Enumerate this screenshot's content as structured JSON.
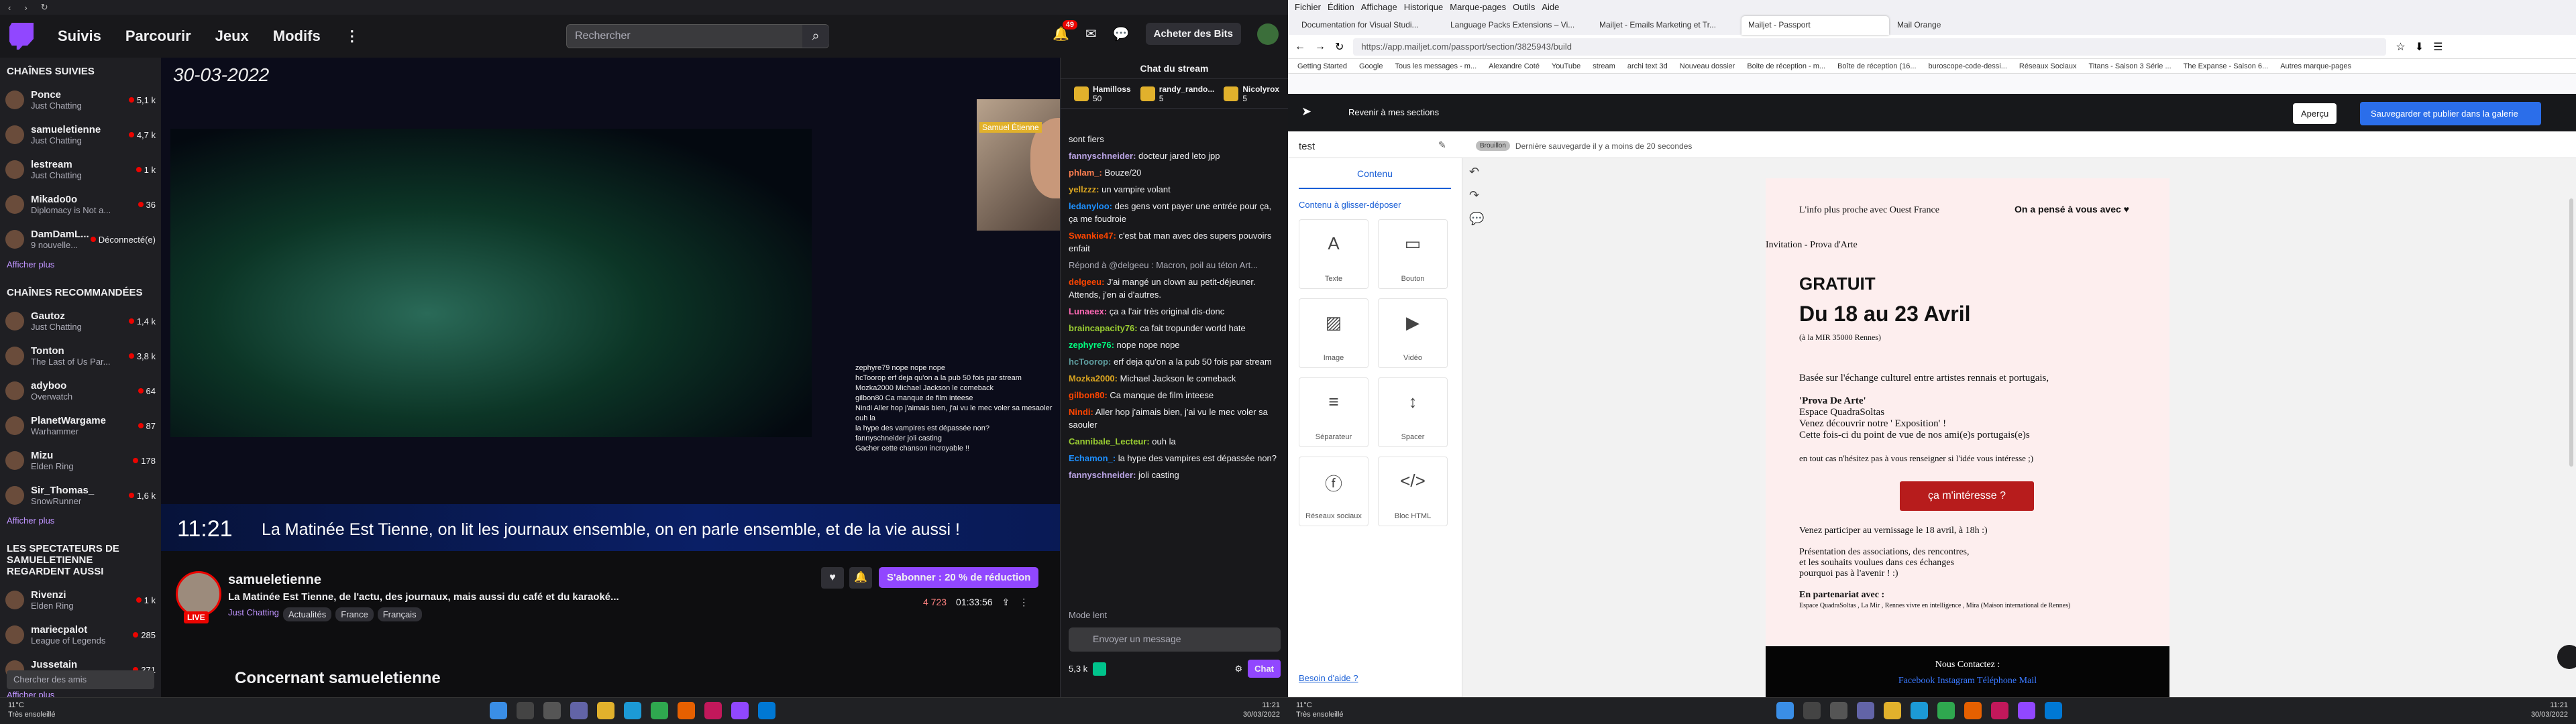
{
  "twitch": {
    "chrome_nav": [
      "‹",
      "›",
      "↻"
    ],
    "nav": {
      "following": "Suivis",
      "browse": "Parcourir",
      "games": "Jeux",
      "mods": "Modifs",
      "more": "⋮"
    },
    "search_placeholder": "Rechercher",
    "notif_count": "49",
    "bits_label": "Acheter des Bits",
    "sidebar": {
      "followed_title": "Chaînes suivies",
      "followed": [
        {
          "name": "Ponce",
          "game": "Just Chatting",
          "viewers": "5,1 k"
        },
        {
          "name": "samueletienne",
          "game": "Just Chatting",
          "viewers": "4,7 k"
        },
        {
          "name": "lestream",
          "game": "Just Chatting",
          "viewers": "1 k"
        },
        {
          "name": "Mikado0o",
          "game": "Diplomacy is Not a...",
          "viewers": "36"
        },
        {
          "name": "DamDamL...",
          "game": "9 nouvelle...",
          "viewers": "Déconnecté(e)"
        }
      ],
      "show_more": "Afficher plus",
      "recommended_title": "Chaînes recommandées",
      "recommended": [
        {
          "name": "Gautoz",
          "game": "Just Chatting",
          "viewers": "1,4 k"
        },
        {
          "name": "Tonton",
          "game": "The Last of Us Par...",
          "viewers": "3,8 k"
        },
        {
          "name": "adyboo",
          "game": "Overwatch",
          "viewers": "64"
        },
        {
          "name": "PlanetWargame",
          "game": "Warhammer",
          "viewers": "87"
        },
        {
          "name": "Mizu",
          "game": "Elden Ring",
          "viewers": "178"
        },
        {
          "name": "Sir_Thomas_",
          "game": "SnowRunner",
          "viewers": "1,6 k"
        }
      ],
      "show_more2": "Afficher plus",
      "viewers_title": "Les spectateurs de samueletienne regardent aussi",
      "viewers_also": [
        {
          "name": "Rivenzi",
          "game": "Elden Ring",
          "viewers": "1 k"
        },
        {
          "name": "mariecpalot",
          "game": "League of Legends",
          "viewers": "285"
        },
        {
          "name": "Jussetain",
          "game": "Mario Kart 8 Deluxe",
          "viewers": "371"
        }
      ],
      "show_more3": "Afficher plus",
      "search_friends": "Chercher des amis"
    },
    "player": {
      "date": "30-03-2022",
      "time": "11:21",
      "ticker": "La Matinée Est Tienne, on lit les journaux ensemble, on en parle ensemble, et de la vie aussi !",
      "overlay_chat": [
        "zephyre79  nope nope nope",
        "hcToorop  erf deja qu'on a la pub 50 fois par stream",
        "Mozka2000  Michael Jackson le comeback",
        "gilbon80  Ca manque de film inteese",
        "Nindi  Aller hop j'aimais bien, j'ai vu le mec voler sa mesaoler",
        "  ouh la",
        "  la hype des vampires est dépassée non?",
        "fannyschneider  joli casting",
        "  Gacher cette chanson incroyable !!"
      ],
      "cam_label": "Samuel Étienne"
    },
    "info": {
      "channel": "samueletienne",
      "title": "La Matinée Est Tienne, de l'actu, des journaux, mais aussi du café et du karaoké...",
      "category": "Just Chatting",
      "tags": [
        "Actualités",
        "France",
        "Français"
      ],
      "live": "LIVE",
      "subscribe": "S'abonner : 20 % de réduction",
      "viewers": "4 723",
      "uptime": "01:33:56",
      "about": "Concernant samueletienne"
    },
    "chat": {
      "header": "Chat du stream",
      "gifts": [
        {
          "name": "Hamilloss",
          "count": "50"
        },
        {
          "name": "randy_rando...",
          "count": "5"
        },
        {
          "name": "Nicolyrox",
          "count": "5"
        }
      ],
      "messages": [
        {
          "user": "",
          "color": "#efeff1",
          "text": "sont fiers"
        },
        {
          "user": "fannyschneider:",
          "color": "#b9a3e3",
          "text": "docteur jared leto jpp"
        },
        {
          "user": "phlam_:",
          "color": "#ff7f50",
          "text": "Bouze/20"
        },
        {
          "user": "yellzzz:",
          "color": "#daa520",
          "text": "un vampire volant"
        },
        {
          "user": "ledanyloo:",
          "color": "#1e90ff",
          "text": "des gens vont payer une entrée pour ça, ça me foudroie"
        },
        {
          "user": "Swankie47:",
          "color": "#ff4500",
          "text": "c'est bat man avec des supers pouvoirs enfait"
        },
        {
          "user": "",
          "color": "#adadb8",
          "text": "Répond à @delgeeu : Macron, poil au téton Art..."
        },
        {
          "user": "delgeeu:",
          "color": "#ff4500",
          "text": "J'ai mangé un clown au petit-déjeuner. Attends, j'en ai d'autres."
        },
        {
          "user": "Lunaeex:",
          "color": "#ff69b4",
          "text": "ça a l'air très original dis-donc"
        },
        {
          "user": "braincapacity76:",
          "color": "#9acd32",
          "text": "ca fait tropunder world hate"
        },
        {
          "user": "zephyre76:",
          "color": "#00ff7f",
          "text": "nope nope nope"
        },
        {
          "user": "hcToorop:",
          "color": "#5f9ea0",
          "text": "erf deja qu'on a la pub 50 fois par stream"
        },
        {
          "user": "Mozka2000:",
          "color": "#daa520",
          "text": "Michael Jackson le comeback"
        },
        {
          "user": "gilbon80:",
          "color": "#ff4500",
          "text": "Ca manque de film inteese"
        },
        {
          "user": "Nindi:",
          "color": "#ff4500",
          "text": "Aller hop j'aimais bien, j'ai vu le mec voler sa saouler"
        },
        {
          "user": "Cannibale_Lecteur:",
          "color": "#9acd32",
          "text": "ouh la"
        },
        {
          "user": "Echamon_:",
          "color": "#1e90ff",
          "text": "la hype des vampires est dépassée non?"
        },
        {
          "user": "fannyschneider:",
          "color": "#b9a3e3",
          "text": "joli casting"
        }
      ],
      "mode": "Mode lent",
      "input_placeholder": "Envoyer un message",
      "points": "5,3 k",
      "send": "Chat"
    }
  },
  "firefox": {
    "menu": [
      "Fichier",
      "Édition",
      "Affichage",
      "Historique",
      "Marque-pages",
      "Outils",
      "Aide"
    ],
    "tabs": [
      "Documentation for Visual Studi...",
      "Language Packs Extensions – Vi...",
      "Mailjet - Emails Marketing et Tr...",
      "Mailjet - Passport",
      "Mail Orange"
    ],
    "url": "https://app.mailjet.com/passport/section/3825943/build",
    "bookmarks": [
      "Getting Started",
      "Google",
      "Tous les messages - m...",
      "Alexandre Coté",
      "YouTube",
      "stream",
      "archi text 3d",
      "Nouveau dossier",
      "Boite de réception - m...",
      "Boîte de réception (16...",
      "buroscope-code-dessi...",
      "Réseaux Sociaux",
      "Titans - Saison 3 Série ...",
      "The Expanse - Saison 6...",
      "Autres marque-pages"
    ]
  },
  "mailjet": {
    "back": "Revenir à mes sections",
    "cancel": "Aperçu",
    "save": "Sauvegarder et publier dans la galerie",
    "name": "test",
    "draft_badge": "Brouillon",
    "draft_text": "Dernière sauvegarde il y a moins de 20 secondes",
    "content_tab": "Contenu",
    "group": "Contenu à glisser-déposer",
    "blocks": [
      {
        "label": "Texte",
        "icon": "A"
      },
      {
        "label": "Bouton",
        "icon": "▭"
      },
      {
        "label": "Image",
        "icon": "▨"
      },
      {
        "label": "Vidéo",
        "icon": "▶"
      },
      {
        "label": "Séparateur",
        "icon": "≡"
      },
      {
        "label": "Spacer",
        "icon": "↕"
      },
      {
        "label": "Réseaux sociaux",
        "icon": "ⓕ"
      },
      {
        "label": "Bloc HTML",
        "icon": "</>"
      }
    ],
    "help": "Besoin d'aide ?",
    "email": {
      "head_left": "L'info plus proche avec Ouest France",
      "head_right": "On a pensé à vous avec ♥",
      "invitation": "Invitation - Prova d'Arte",
      "gratuit": "GRATUIT",
      "dates": "Du 18 au 23 Avril",
      "where": "(à la MIR 35000 Rennes)",
      "body1": "Basée sur l'échange culturel entre artistes rennais et portugais,",
      "body2": "'Prova De Arte'",
      "body3": "Espace QuadraSoltas",
      "body4": "Venez découvrir notre ' Exposition' !",
      "body5": "Cette fois-ci du point de vue de nos ami(e)s portugais(e)s",
      "body6": "en tout cas n'hésitez pas à vous renseigner si l'idée vous intéresse ;)",
      "cta": "ça m'intéresse ?",
      "body7": "Venez participer au vernissage le 18 avril, à 18h :)",
      "body8": "Présentation des associations, des rencontres,",
      "body9": "et les souhaits voulues dans ces échanges",
      "body10": "pourquoi pas à l'avenir ! :)",
      "partner": "En partenariat avec :",
      "partner_list": "Espace QuadraSoltas , La Mir , Rennes vivre en intelligence , Mira (Maison international de Rennes)",
      "contact": "Nous Contactez :",
      "links": "Facebook Instagram Téléphone Mail"
    }
  },
  "taskbar": {
    "temp": "11°C",
    "weather": "Très ensoleillé",
    "time": "11:21",
    "date": "30/03/2022"
  }
}
